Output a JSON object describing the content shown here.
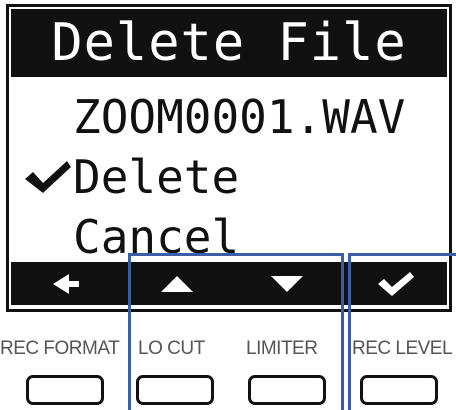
{
  "screen": {
    "title": "Delete File",
    "file_name": "ZOOM0001.WAV",
    "options": [
      "Delete",
      "Cancel"
    ],
    "selected_option": "Delete"
  },
  "softkeys": [
    {
      "icon": "left-arrow-icon"
    },
    {
      "icon": "up-arrow-icon"
    },
    {
      "icon": "down-arrow-icon"
    },
    {
      "icon": "check-icon"
    }
  ],
  "buttons": [
    {
      "label": "REC FORMAT"
    },
    {
      "label": "LO CUT"
    },
    {
      "label": "LIMITER"
    },
    {
      "label": "REC LEVEL"
    }
  ],
  "colors": {
    "lcd_ink": "#111111",
    "frame_blue": "#3a5fa6",
    "label_gray": "#555555"
  }
}
